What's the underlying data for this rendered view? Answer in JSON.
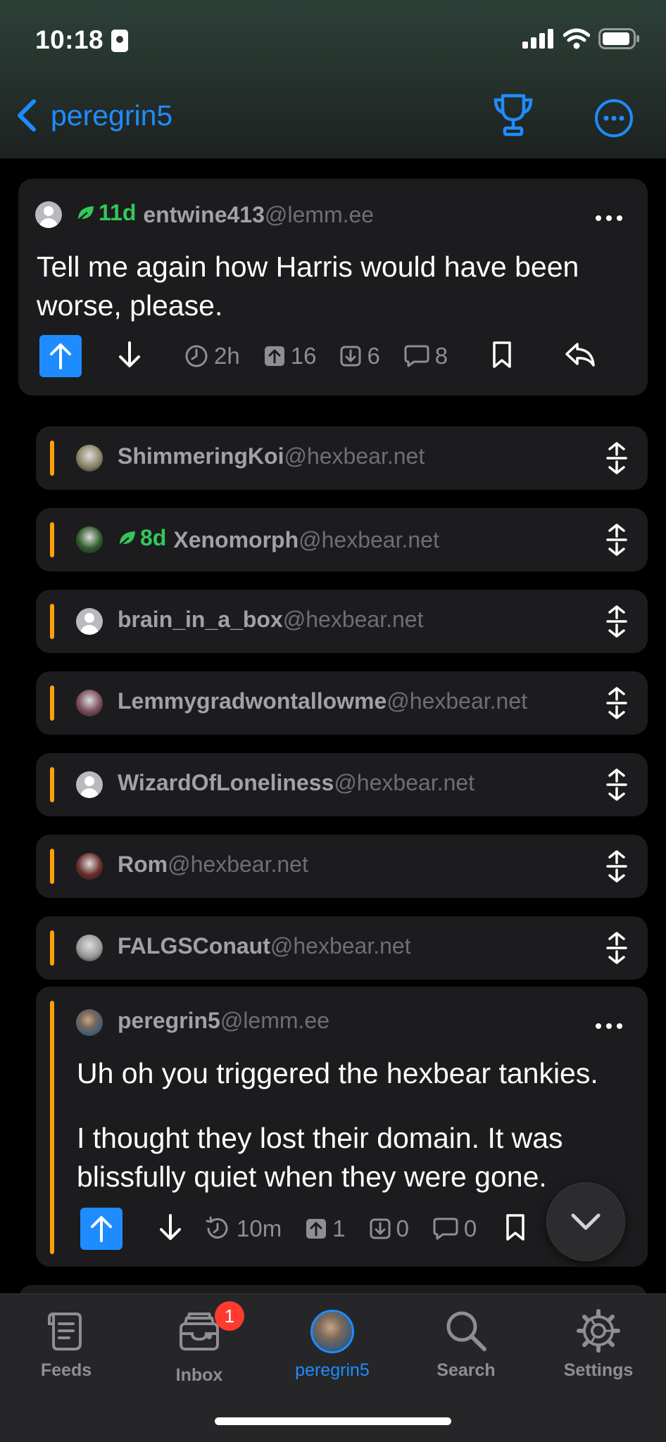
{
  "status_bar": {
    "time": "10:18"
  },
  "nav": {
    "back_label": "peregrin5"
  },
  "post": {
    "age": "11d",
    "author": "entwine413",
    "instance": "@lemm.ee",
    "text": "Tell me again how Harris would have been worse, please.",
    "time": "2h",
    "upvotes": "16",
    "downvotes": "6",
    "comments": "8"
  },
  "collapsed_comments": [
    {
      "author": "ShimmeringKoi",
      "instance": "@hexbear.net",
      "age": "",
      "avatar": "photo",
      "avatar_color": "#8a8466"
    },
    {
      "author": "Xenomorph",
      "instance": "@hexbear.net",
      "age": "8d",
      "avatar": "photo",
      "avatar_color": "#2f5a2a"
    },
    {
      "author": "brain_in_a_box",
      "instance": "@hexbear.net",
      "age": "",
      "avatar": "default",
      "avatar_color": "#b9b9be"
    },
    {
      "author": "Lemmygradwontallowme",
      "instance": "@hexbear.net",
      "age": "",
      "avatar": "photo",
      "avatar_color": "#7a4a5a"
    },
    {
      "author": "WizardOfLoneliness",
      "instance": "@hexbear.net",
      "age": "",
      "avatar": "default",
      "avatar_color": "#b9b9be"
    },
    {
      "author": "Rom",
      "instance": "@hexbear.net",
      "age": "",
      "avatar": "photo",
      "avatar_color": "#6a2a2a"
    },
    {
      "author": "FALGSConaut",
      "instance": "@hexbear.net",
      "age": "",
      "avatar": "photo",
      "avatar_color": "#9a9a9a"
    }
  ],
  "reply": {
    "author": "peregrin5",
    "instance": "@lemm.ee",
    "paragraph1": "Uh oh you triggered the hexbear tankies.",
    "paragraph2": "I thought they lost their domain. It was blissfully quiet when they were gone.",
    "time": "10m",
    "upvotes": "1",
    "downvotes": "0",
    "comments": "0"
  },
  "tabs": [
    {
      "label": "Feeds",
      "icon": "feeds-icon"
    },
    {
      "label": "Inbox",
      "icon": "inbox-icon",
      "badge": "1"
    },
    {
      "label": "peregrin5",
      "icon": "profile-avatar",
      "active": true
    },
    {
      "label": "Search",
      "icon": "search-icon"
    },
    {
      "label": "Settings",
      "icon": "gear-icon"
    }
  ],
  "colors": {
    "accent": "#1e8cff",
    "thread_bar": "#ffa00a",
    "new_user_green": "#34c759"
  }
}
